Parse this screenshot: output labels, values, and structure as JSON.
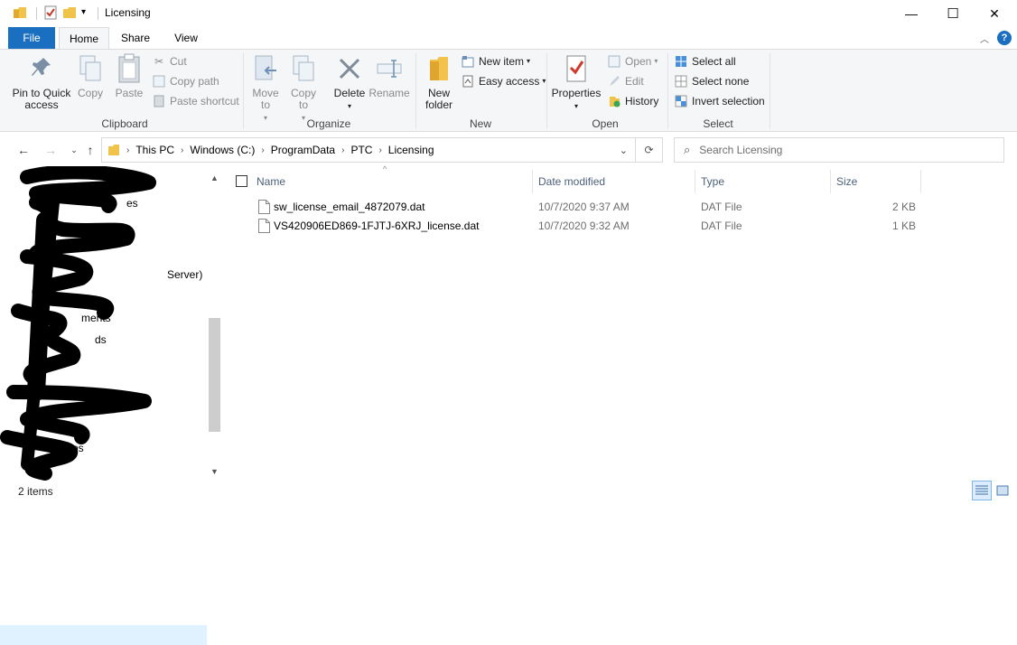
{
  "window": {
    "title": "Licensing",
    "controls": {
      "minimize": "—",
      "maximize": "☐",
      "close": "✕"
    }
  },
  "tabs": {
    "file": "File",
    "home": "Home",
    "share": "Share",
    "view": "View"
  },
  "ribbon": {
    "clipboard": {
      "label": "Clipboard",
      "pin": "Pin to Quick access",
      "copy": "Copy",
      "paste": "Paste",
      "cut": "Cut",
      "copy_path": "Copy path",
      "paste_shortcut": "Paste shortcut"
    },
    "organize": {
      "label": "Organize",
      "move_to": "Move to",
      "copy_to": "Copy to",
      "delete": "Delete",
      "rename": "Rename"
    },
    "new": {
      "label": "New",
      "new_folder": "New folder",
      "new_item": "New item",
      "easy_access": "Easy access"
    },
    "open": {
      "label": "Open",
      "properties": "Properties",
      "open": "Open",
      "edit": "Edit",
      "history": "History"
    },
    "select": {
      "label": "Select",
      "select_all": "Select all",
      "select_none": "Select none",
      "invert_selection": "Invert selection"
    }
  },
  "address": {
    "crumbs": [
      "This PC",
      "Windows (C:)",
      "ProgramData",
      "PTC",
      "Licensing"
    ],
    "search_placeholder": "Search Licensing"
  },
  "nav": {
    "visible_fragments": [
      "es",
      "Server)",
      "ments",
      "ds",
      "os"
    ]
  },
  "columns": {
    "name": "Name",
    "date": "Date modified",
    "type": "Type",
    "size": "Size"
  },
  "files": [
    {
      "name": "sw_license_email_4872079.dat",
      "date": "10/7/2020 9:37 AM",
      "type": "DAT File",
      "size": "2 KB"
    },
    {
      "name": "VS420906ED869-1FJTJ-6XRJ_license.dat",
      "date": "10/7/2020 9:32 AM",
      "type": "DAT File",
      "size": "1 KB"
    }
  ],
  "status": {
    "count": "2 items"
  },
  "colors": {
    "accent": "#1a6fc0",
    "ribbon_bg": "#f5f6f7",
    "header_text": "#4c607a"
  }
}
